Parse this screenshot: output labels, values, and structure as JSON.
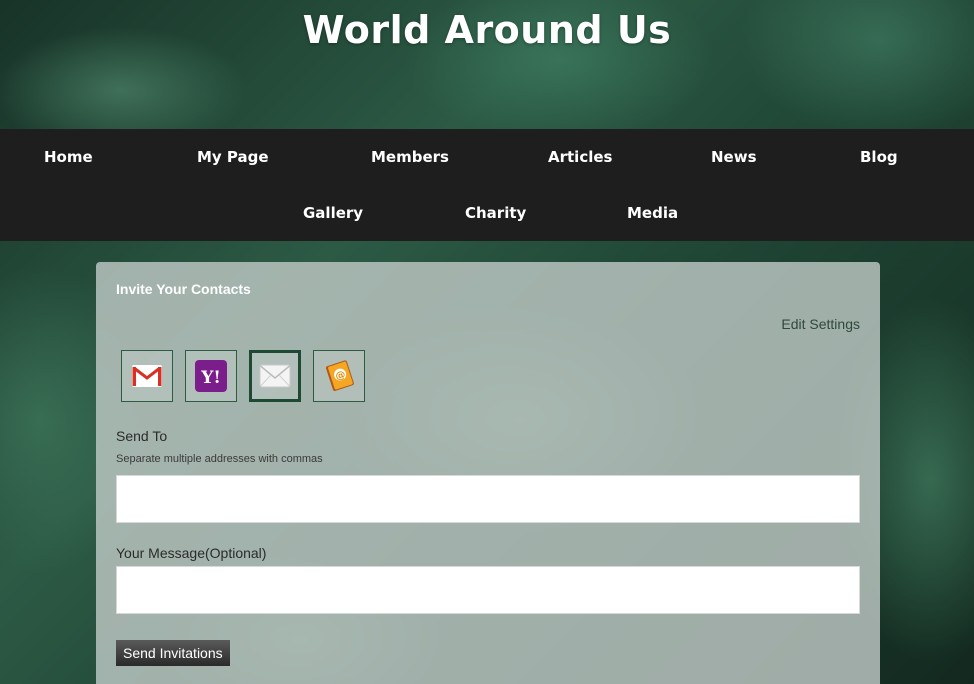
{
  "header": {
    "site_title": "World Around Us"
  },
  "nav": {
    "items": [
      {
        "label": "Home"
      },
      {
        "label": "My Page"
      },
      {
        "label": "Members"
      },
      {
        "label": "Articles"
      },
      {
        "label": "News"
      },
      {
        "label": "Blog"
      },
      {
        "label": "Gallery"
      },
      {
        "label": "Charity"
      },
      {
        "label": "Media"
      }
    ]
  },
  "invite": {
    "title": "Invite Your Contacts",
    "edit_settings": "Edit Settings",
    "providers": [
      {
        "icon": "gmail-icon",
        "selected": false
      },
      {
        "icon": "yahoo-icon",
        "selected": false
      },
      {
        "icon": "email-envelope-icon",
        "selected": true
      },
      {
        "icon": "address-book-icon",
        "selected": false
      }
    ],
    "send_to_label": "Send To",
    "send_to_hint": "Separate multiple addresses with commas",
    "send_to_value": "",
    "message_label": "Your Message(Optional)",
    "message_value": "",
    "send_button": "Send Invitations"
  },
  "colors": {
    "nav_background": "#1e1e1e",
    "panel_background": "#bec8c4",
    "provider_border": "#2f5a43"
  }
}
